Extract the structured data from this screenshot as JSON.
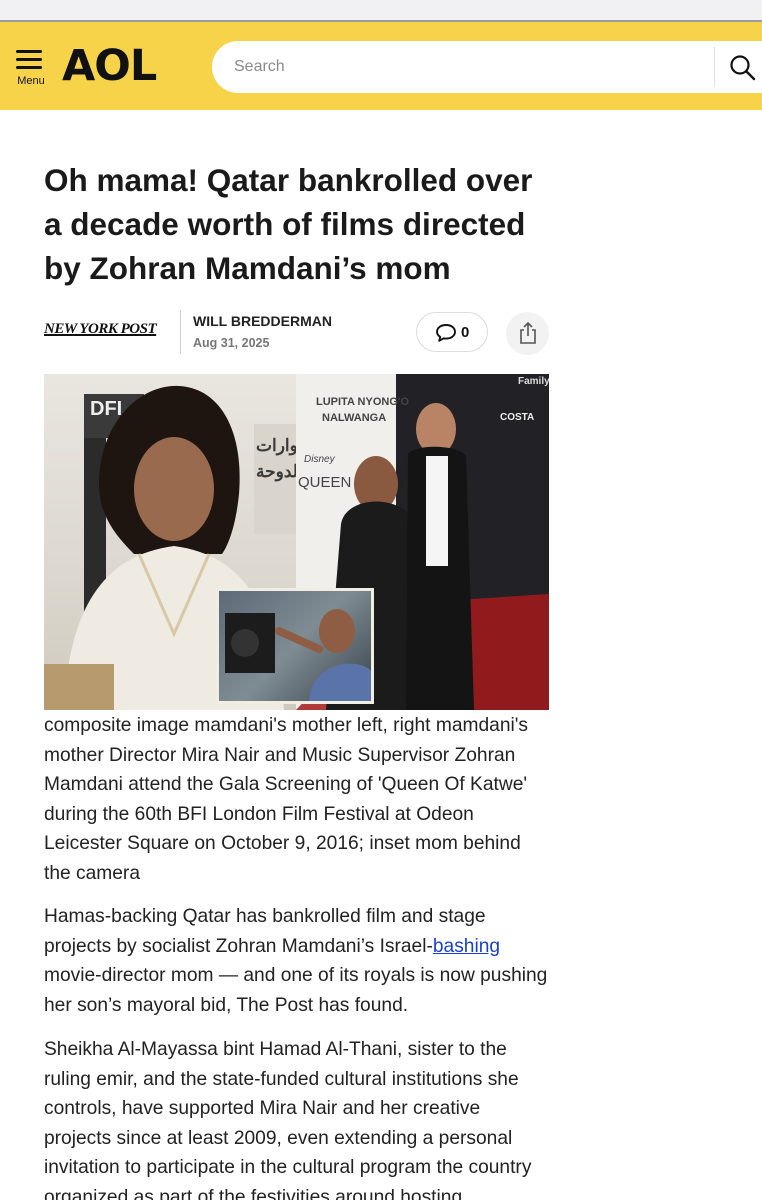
{
  "header": {
    "menu_label": "Menu",
    "logo": "AOL",
    "search_placeholder": "Search",
    "search_icon": "search-icon",
    "brand_color": "#f6d348"
  },
  "article": {
    "title": "Oh mama! Qatar bankrolled over a decade worth of films directed by Zohran Mamdani’s mom",
    "publisher": "NEW YORK POST",
    "author": "WILL BREDDERMAN",
    "date": "Aug 31, 2025",
    "comment_count": "0",
    "comment_icon": "comment-icon",
    "share_icon": "share-icon",
    "photo": {
      "left_sign_text": [
        "DFI",
        "حوارات",
        "الدوحة"
      ],
      "right_backdrop_text": [
        "LUPITA NYONG'O",
        "NALWANGA",
        "Disney",
        "QUEEN",
        "COSTA",
        "Family"
      ]
    },
    "caption": "composite image mamdani's mother left, right mamdani's mother Director Mira Nair and Music Supervisor Zohran Mamdani attend the Gala Screening of 'Queen Of Katwe' during the 60th BFI London Film Festival at Odeon Leicester Square on October 9, 2016; inset mom behind the camera",
    "paragraphs": [
      {
        "before": "Hamas-backing Qatar has bankrolled film and stage projects by socialist Zohran Mamdani’s Israel-",
        "link": "bashing",
        "after": " movie-director mom — and one of its royals is now pushing her son’s mayoral bid, The Post has found."
      },
      {
        "text": "Sheikha Al-Mayassa bint Hamad Al-Thani, sister to the ruling emir, and the state-funded cultural institutions she controls, have supported Mira Nair and her creative projects since at least 2009, even extending a personal invitation to participate in the cultural program the country organized as part of the festivities around hosting"
      }
    ]
  }
}
